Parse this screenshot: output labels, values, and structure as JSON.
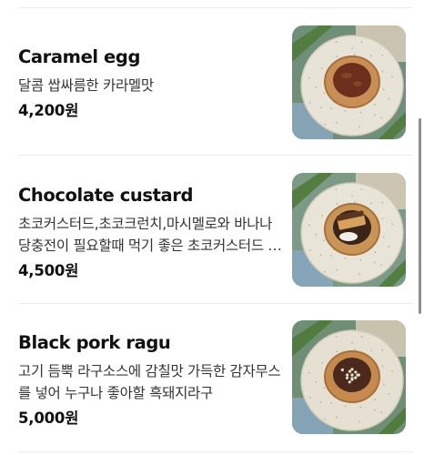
{
  "menu": {
    "items": [
      {
        "name": "Caramel egg",
        "description": "달콤 쌉싸름한 카라멜맛",
        "price": "4,200원",
        "photo_icon": "egg-tart-photo",
        "topping": "caramel",
        "colors": {
          "bg": "#6f8f79",
          "plate": "#e8e3d7",
          "pastry": "#c98e55",
          "filling": "#6b2f1c"
        }
      },
      {
        "name": "Chocolate custard",
        "description": "초코커스터드,초코크런치,마시멜로와 바나나 당충전이 필요할때 먹기 좋은 초코커스터드 타르트",
        "price": "4,500원",
        "photo_icon": "chocolate-tart-photo",
        "topping": "chocolate",
        "colors": {
          "bg": "#7c9a86",
          "plate": "#e9e4d8",
          "pastry": "#c99457",
          "filling": "#3a2418"
        }
      },
      {
        "name": "Black pork ragu",
        "description": "고기 듬뿍 라구소스에 감칠맛 가득한 감자무스를 넣어 누구나 좋아할 흑돼지라구",
        "price": "5,000원",
        "photo_icon": "ragu-tart-photo",
        "topping": "ragu",
        "colors": {
          "bg": "#6e8f74",
          "plate": "#e6e0d2",
          "pastry": "#c58a4d",
          "filling": "#4b2a1d"
        }
      }
    ]
  }
}
